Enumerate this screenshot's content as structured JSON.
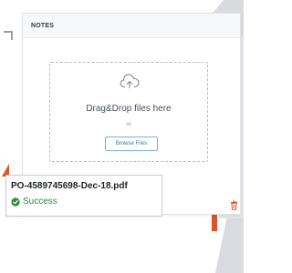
{
  "notes_panel": {
    "title": "NOTES",
    "dropzone": {
      "title": "Drag&Drop files here",
      "or_text": "or",
      "browse_label": "Browse Files"
    }
  },
  "upload_item": {
    "filename": "PO-4589745698-Dec-18.pdf",
    "status": "Success"
  },
  "icons": [
    "cloud-upload-icon",
    "check-circle-icon",
    "trash-icon"
  ],
  "colors": {
    "success": "#2f8c3c",
    "accent_blue": "#3a78b8",
    "warning_orange": "#e2502a"
  }
}
